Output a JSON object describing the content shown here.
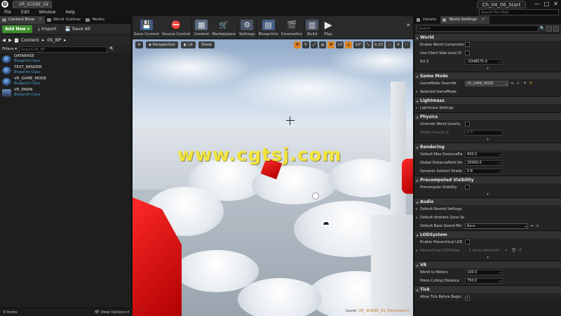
{
  "window": {
    "doc_tab": "VR_SCENE_01",
    "project_name": "Ch_04_06_Start",
    "min": "—",
    "max": "□",
    "close": "✕"
  },
  "menu": [
    "File",
    "Edit",
    "Window",
    "Help"
  ],
  "search_help": "Search For Help",
  "left_panel": {
    "tabs": [
      {
        "label": "Content Brow"
      },
      {
        "label": "World Outliner"
      },
      {
        "label": "Modes"
      }
    ],
    "add_new": "Add New ▾",
    "import": "Import",
    "save_all": "Save All",
    "path": [
      "Content",
      "05_BP"
    ],
    "filters": "Filters ▾",
    "search_placeholder": "Search 05_BP",
    "assets": [
      {
        "name": "DATABASE",
        "type": "Blueprint Class"
      },
      {
        "name": "TEXT_RENDER",
        "type": "Blueprint Class"
      },
      {
        "name": "VR_GAME_MODE",
        "type": "Blueprint Class"
      },
      {
        "name": "VR_PAWN",
        "type": "Blueprint Class"
      }
    ],
    "item_count": "4 items",
    "view_options": "View Options ▾"
  },
  "toolbar": [
    {
      "label": "Save Current",
      "icon": "save-icon",
      "glyph": "💾"
    },
    {
      "label": "Source Control",
      "icon": "source-control-icon",
      "glyph": "⛔"
    },
    {
      "label": "Content",
      "icon": "content-icon",
      "glyph": "▦"
    },
    {
      "label": "Marketplace",
      "icon": "marketplace-icon",
      "glyph": "🛒"
    },
    {
      "label": "Settings",
      "icon": "settings-icon",
      "glyph": "⚙"
    },
    {
      "label": "Blueprints",
      "icon": "blueprints-icon",
      "glyph": "▤"
    },
    {
      "label": "Cinematics",
      "icon": "cinematics-icon",
      "glyph": "🎬"
    },
    {
      "label": "Build",
      "icon": "build-icon",
      "glyph": "▥"
    },
    {
      "label": "Play",
      "icon": "play-icon",
      "glyph": "▶"
    }
  ],
  "viewport": {
    "perspective": "Perspective",
    "lit": "Lit",
    "show": "Show",
    "grid_snap": "10",
    "rot_snap": "10°",
    "scale_snap": "0.25",
    "camera_speed": "4",
    "watermark": "www.cgtsj.com",
    "level_label": "Level:",
    "level_name": "VR_SCENE_01 (Persistent)"
  },
  "right_panel": {
    "tabs": [
      {
        "label": "Details"
      },
      {
        "label": "World Settings"
      }
    ],
    "search_placeholder": "Search",
    "categories": {
      "world": "World",
      "game_mode": "Game Mode",
      "lightmass": "Lightmass",
      "physics": "Physics",
      "rendering": "Rendering",
      "precomputed": "Precomputed Visibility",
      "audio": "Audio",
      "lod": "LODSystem",
      "vr": "VR",
      "tick": "Tick"
    },
    "props": {
      "enable_world_comp": "Enable World Compositio",
      "use_client_side": "Use Client Side Level St",
      "kill_z": "Kill Z",
      "kill_z_val": "-1048575.0",
      "gamemode_override": "GameMode Override",
      "gamemode_val": "VR_GAME_MODE",
      "selected_gamemode": "Selected GameMode",
      "lightmass_settings": "Lightmass Settings",
      "override_gravity": "Override World Gravity",
      "global_gravity": "Global Gravity Z",
      "global_gravity_val": "0.0",
      "max_distance": "Default Max DistanceFie",
      "max_distance_val": "600.0",
      "global_df": "Global DistanceField Vie",
      "global_df_val": "20000.0",
      "dyn_indirect": "Dynamic Indirect Shado",
      "dyn_indirect_val": "0.8",
      "precompute_vis": "Precompute Visibility",
      "reverb": "Default Reverb Settings",
      "ambient": "Default Ambient Zone Se",
      "base_sound": "Default Base Sound Mix",
      "base_sound_val": "None",
      "enable_hlod": "Enable Hierarchical LOD",
      "hlod_setup": "Hierarchical LODSetup",
      "hlod_array": "1 Array elements",
      "world_to_meters": "World to Meters",
      "world_to_meters_val": "100.0",
      "mono_culling": "Mono Culling Distance",
      "mono_culling_val": "750.0",
      "allow_tick": "Allow Tick Before Begin"
    }
  },
  "colors": {
    "add_new": "#3c8f2d",
    "accent_orange": "#d98324",
    "blueprint_type": "#4ea2d6"
  }
}
